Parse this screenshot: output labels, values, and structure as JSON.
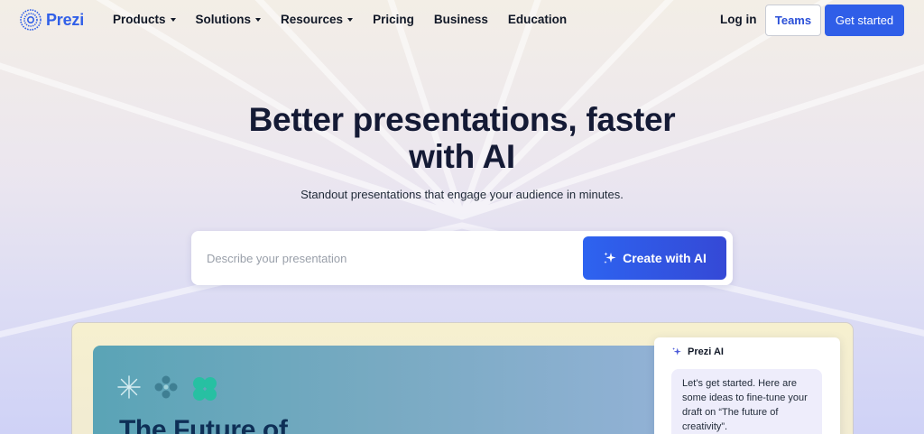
{
  "nav": {
    "logo_text": "Prezi",
    "items": [
      {
        "label": "Products",
        "dropdown": true
      },
      {
        "label": "Solutions",
        "dropdown": true
      },
      {
        "label": "Resources",
        "dropdown": true
      },
      {
        "label": "Pricing",
        "dropdown": false
      },
      {
        "label": "Business",
        "dropdown": false
      },
      {
        "label": "Education",
        "dropdown": false
      }
    ],
    "login_label": "Log in",
    "teams_label": "Teams",
    "get_started_label": "Get started"
  },
  "hero": {
    "headline_line1": "Better presentations, faster",
    "headline_line2": "with AI",
    "subheadline": "Standout presentations that engage your audience in minutes.",
    "prompt_placeholder": "Describe your presentation",
    "create_button_label": "Create with AI"
  },
  "preview": {
    "slide_title": "The Future of",
    "ai_panel_title": "Prezi AI",
    "ai_message": "Let’s get started. Here are some ideas to fine-tune your draft on “The future of creativity”."
  },
  "colors": {
    "brand_blue": "#2f5ee8",
    "headline": "#141a35",
    "slide_teal": "#5aa4b6"
  }
}
